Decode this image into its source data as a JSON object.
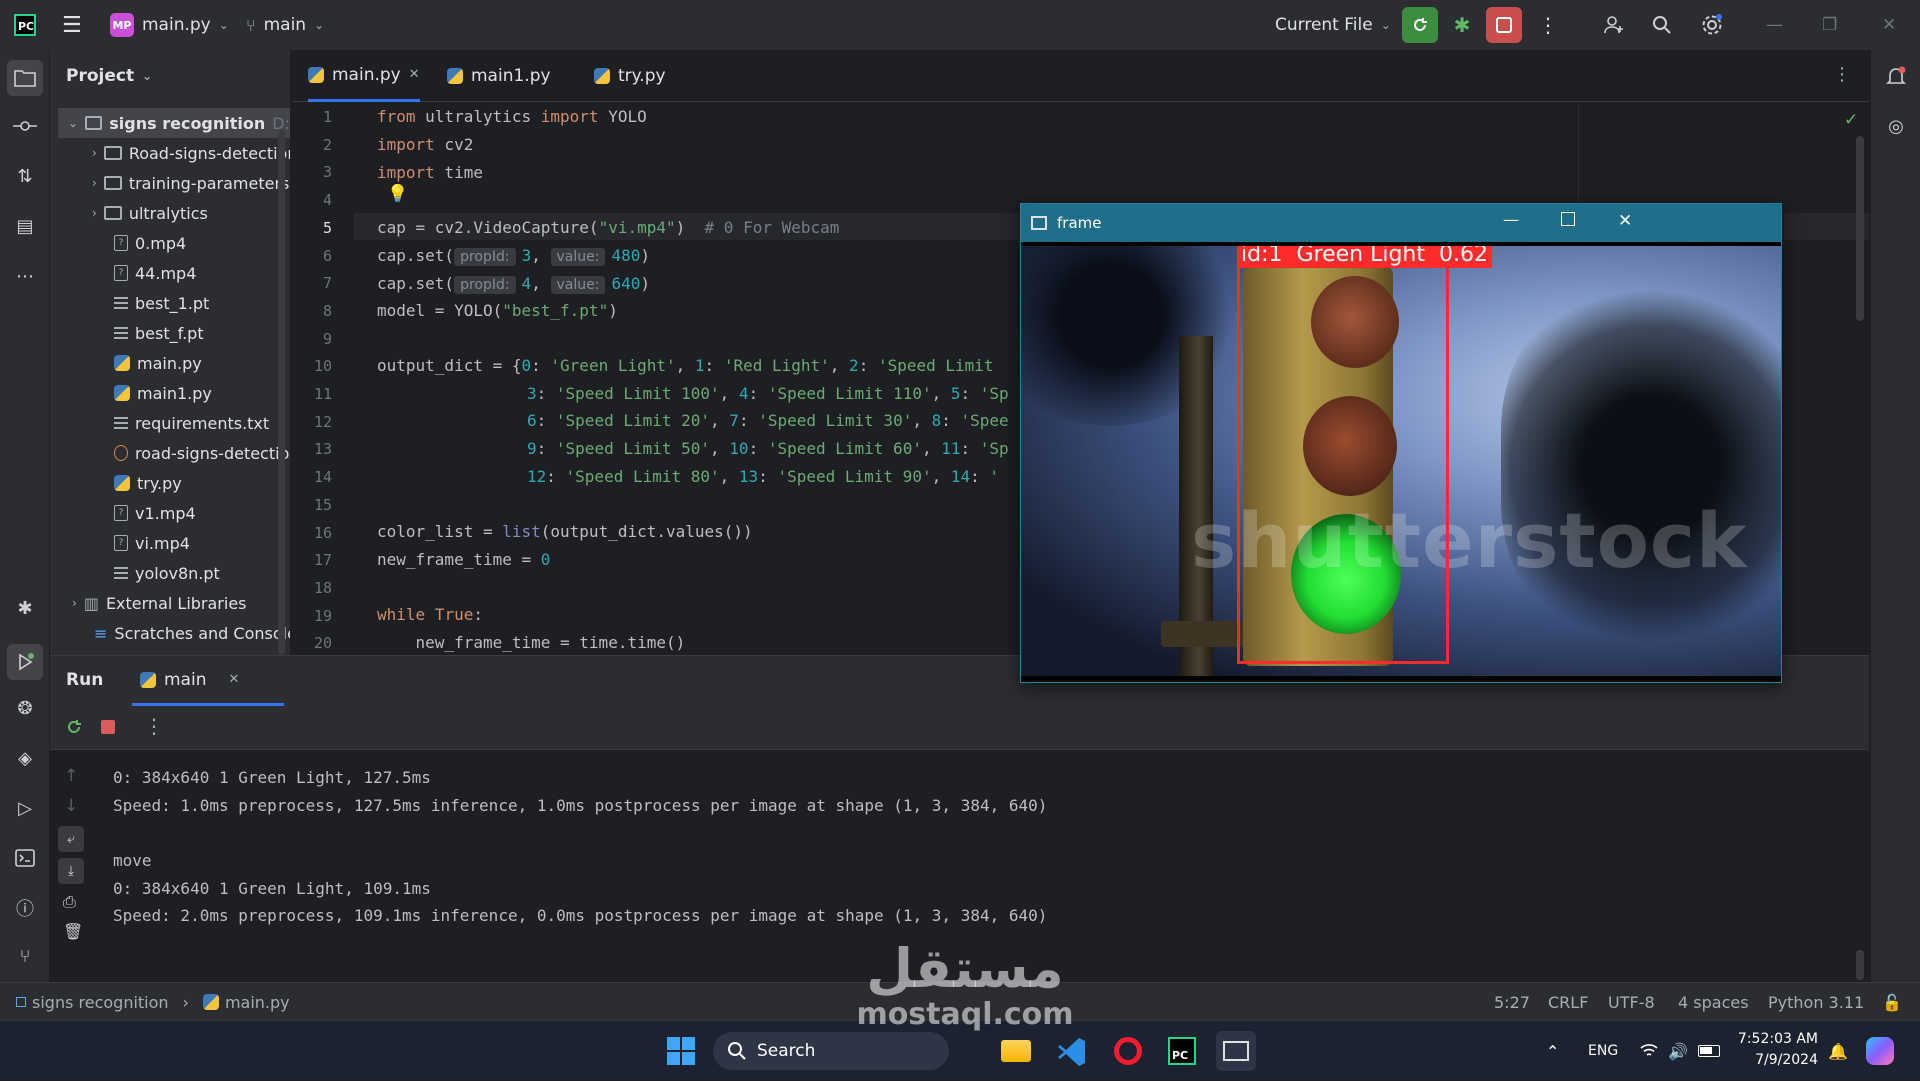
{
  "titlebar": {
    "project_badge": "MP",
    "project_file": "main.py",
    "branch": "main",
    "run_config": "Current File"
  },
  "project_panel": {
    "title": "Project",
    "root": "signs recognition",
    "root_suffix": "D:",
    "items": [
      {
        "label": "Road-signs-detection",
        "kind": "folder"
      },
      {
        "label": "training-parameters",
        "kind": "folder"
      },
      {
        "label": "ultralytics",
        "kind": "folder"
      },
      {
        "label": "0.mp4",
        "kind": "unknown"
      },
      {
        "label": "44.mp4",
        "kind": "unknown"
      },
      {
        "label": "best_1.pt",
        "kind": "text"
      },
      {
        "label": "best_f.pt",
        "kind": "text"
      },
      {
        "label": "main.py",
        "kind": "python"
      },
      {
        "label": "main1.py",
        "kind": "python"
      },
      {
        "label": "requirements.txt",
        "kind": "text"
      },
      {
        "label": "road-signs-detection",
        "kind": "notebook"
      },
      {
        "label": "try.py",
        "kind": "python"
      },
      {
        "label": "v1.mp4",
        "kind": "unknown"
      },
      {
        "label": "vi.mp4",
        "kind": "unknown"
      },
      {
        "label": "yolov8n.pt",
        "kind": "text"
      }
    ],
    "external_libraries": "External Libraries",
    "scratches": "Scratches and Consoles"
  },
  "editor": {
    "tabs": [
      {
        "label": "main.py",
        "active": true
      },
      {
        "label": "main1.py",
        "active": false
      },
      {
        "label": "try.py",
        "active": false
      }
    ],
    "line_numbers": [
      "1",
      "2",
      "3",
      "4",
      "5",
      "6",
      "7",
      "8",
      "9",
      "10",
      "11",
      "12",
      "13",
      "14",
      "15",
      "16",
      "17",
      "18",
      "19",
      "20"
    ],
    "code": {
      "l1_a": "from",
      "l1_b": " ultralytics ",
      "l1_c": "import",
      "l1_d": " YOLO",
      "l2_a": "import",
      "l2_b": " cv2",
      "l3_a": "import",
      "l3_b": " time",
      "l5_a": "cap = cv2.VideoCapture(",
      "l5_b": "\"vi.mp4\"",
      "l5_c": ")  ",
      "l5_d": "# 0 For Webcam",
      "l6_a": "cap.set(",
      "l6_h1": "propId:",
      "l6_b": "3",
      "l6_c": ", ",
      "l6_h2": "value:",
      "l6_d": "480",
      "l6_e": ")",
      "l7_a": "cap.set(",
      "l7_h1": "propId:",
      "l7_b": "4",
      "l7_c": ", ",
      "l7_h2": "value:",
      "l7_d": "640",
      "l7_e": ")",
      "l8_a": "model = YOLO(",
      "l8_b": "\"best_f.pt\"",
      "l8_c": ")",
      "l10_a": "output_dict = {",
      "l10_b": "0",
      "l10_c": ": ",
      "l10_d": "'Green Light'",
      "l10_e": ", ",
      "l10_f": "1",
      "l10_g": ": ",
      "l10_h": "'Red Light'",
      "l10_i": ", ",
      "l10_j": "2",
      "l10_k": ": ",
      "l10_l": "'Speed Limit",
      "l11_a": "3",
      "l11_b": ": ",
      "l11_c": "'Speed Limit 100'",
      "l11_d": ", ",
      "l11_e": "4",
      "l11_f": ": ",
      "l11_g": "'Speed Limit 110'",
      "l11_h": ", ",
      "l11_i": "5",
      "l11_j": ": ",
      "l11_k": "'Sp",
      "l12_a": "6",
      "l12_b": ": ",
      "l12_c": "'Speed Limit 20'",
      "l12_d": ", ",
      "l12_e": "7",
      "l12_f": ": ",
      "l12_g": "'Speed Limit 30'",
      "l12_h": ", ",
      "l12_i": "8",
      "l12_j": ": ",
      "l12_k": "'Spee",
      "l13_a": "9",
      "l13_b": ": ",
      "l13_c": "'Speed Limit 50'",
      "l13_d": ", ",
      "l13_e": "10",
      "l13_f": ": ",
      "l13_g": "'Speed Limit 60'",
      "l13_h": ", ",
      "l13_i": "11",
      "l13_j": ": ",
      "l13_k": "'Sp",
      "l14_a": "12",
      "l14_b": ": ",
      "l14_c": "'Speed Limit 80'",
      "l14_d": ", ",
      "l14_e": "13",
      "l14_f": ": ",
      "l14_g": "'Speed Limit 90'",
      "l14_h": ", ",
      "l14_i": "14",
      "l14_j": ": ",
      "l14_k": "'",
      "l16_a": "color_list = ",
      "l16_b": "list",
      "l16_c": "(output_dict.values())",
      "l17_a": "new_frame_time = ",
      "l17_b": "0",
      "l19_a": "while",
      "l19_b": " ",
      "l19_c": "True",
      "l19_d": ":",
      "l20_a": "    new_frame_time = time.time()"
    }
  },
  "frame_window": {
    "title": "frame",
    "detection_label": "id:1  Green Light  0.62",
    "watermark": "shutterstock"
  },
  "run_panel": {
    "title": "Run",
    "tab": "main",
    "output": [
      "0: 384x640 1 Green Light, 127.5ms",
      "Speed: 1.0ms preprocess, 127.5ms inference, 1.0ms postprocess per image at shape (1, 3, 384, 640)",
      "",
      "move",
      "0: 384x640 1 Green Light, 109.1ms",
      "Speed: 2.0ms preprocess, 109.1ms inference, 0.0ms postprocess per image at shape (1, 3, 384, 640)"
    ]
  },
  "statusbar": {
    "crumb_project": "signs recognition",
    "crumb_file": "main.py",
    "position": "5:27",
    "line_sep": "CRLF",
    "encoding": "UTF-8",
    "indent": "4 spaces",
    "interpreter": "Python 3.11"
  },
  "taskbar": {
    "search": "Search",
    "lang": "ENG",
    "time": "7:52:03 AM",
    "date": "7/9/2024"
  },
  "watermark": {
    "arabic": "مستقل",
    "latin": "mostaql.com"
  },
  "colors": {
    "accent": "#3574f0",
    "run_green": "#3c8d3f",
    "stop_red": "#c94f4f",
    "detection_red": "#ff2a2a",
    "frame_title": "#1f6f8b"
  }
}
